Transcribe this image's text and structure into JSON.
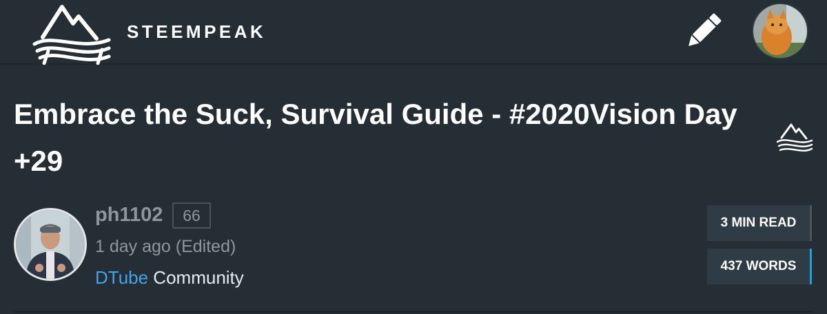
{
  "header": {
    "brand": "STEEMPEAK",
    "logo_icon": "steempeak-mountain-logo-icon",
    "edit_icon": "pencil-icon",
    "avatar_desc": "user-avatar"
  },
  "post": {
    "title": "Embrace the Suck, Survival Guide - #2020Vision Day +29",
    "side_icon": "steempeak-small-logo-icon"
  },
  "author": {
    "name": "ph1102",
    "reputation": "66",
    "time": "1 day ago (Edited)",
    "community_link": "DTube",
    "community_suffix": " Community"
  },
  "stats": {
    "read_time": "3 MIN READ",
    "words": "437 WORDS"
  },
  "colors": {
    "background": "#252e35",
    "accent_link": "#3fa6ec",
    "stat_box": "#303c45",
    "words_accent": "#1fa3d3"
  }
}
